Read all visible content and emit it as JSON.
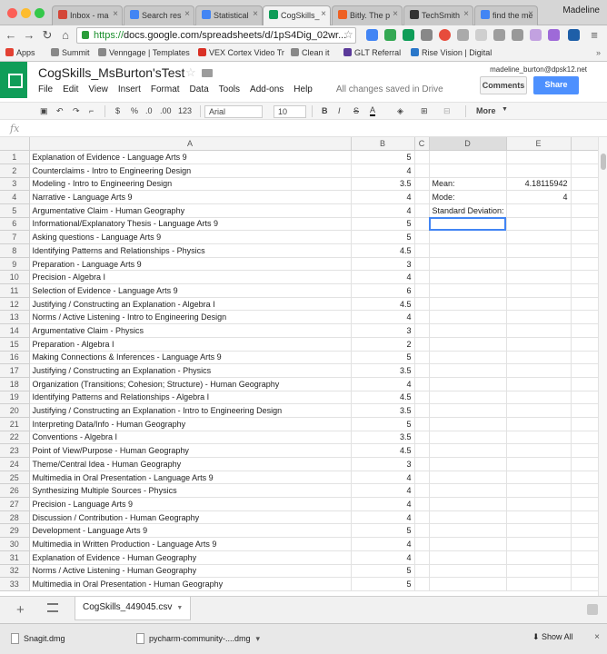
{
  "browser": {
    "tabs": [
      {
        "label": "Inbox - ma",
        "color": "#d44638"
      },
      {
        "label": "Search res",
        "color": "#4285f4"
      },
      {
        "label": "Statistical",
        "color": "#4285f4"
      },
      {
        "label": "CogSkills_",
        "color": "#0f9d58",
        "active": true
      },
      {
        "label": "Bitly. The p",
        "color": "#ee6123"
      },
      {
        "label": "TechSmith",
        "color": "#333333"
      },
      {
        "label": "find the me",
        "color": "#4285f4"
      }
    ],
    "profile": "Madeline",
    "url_scheme": "https://",
    "url_rest": "docs.google.com/spreadsheets/d/1pS4Dig_02wr..."
  },
  "bookmarks": [
    {
      "label": "Apps",
      "color": "#e34133"
    },
    {
      "label": "Summit",
      "color": "#888888"
    },
    {
      "label": "Venngage | Templates",
      "color": "#888888"
    },
    {
      "label": "VEX Cortex Video Tr",
      "color": "#d93025"
    },
    {
      "label": "Clean it",
      "color": "#888888"
    },
    {
      "label": "GLT Referral",
      "color": "#5b3a9a"
    },
    {
      "label": "Rise Vision | Digital",
      "color": "#2a77c9"
    }
  ],
  "docs": {
    "title": "CogSkills_MsBurton'sTest",
    "menu": [
      "File",
      "Edit",
      "View",
      "Insert",
      "Format",
      "Data",
      "Tools",
      "Add-ons",
      "Help"
    ],
    "saved_status": "All changes saved in Drive",
    "user_email": "madeline_burton@dpsk12.net",
    "comments_label": "Comments",
    "share_label": "Share"
  },
  "toolbar": {
    "currency": "$",
    "percent": "%",
    "decrease_decimal": ".0",
    "increase_decimal": ".00",
    "number_format": "123",
    "font": "Arial",
    "font_size": "10",
    "bold": "B",
    "italic": "I",
    "strike": "S",
    "text_color": "A",
    "more": "More"
  },
  "formula_bar": {
    "fx": "fx"
  },
  "grid": {
    "columns": [
      "A",
      "B",
      "C",
      "D",
      "E"
    ],
    "rows": [
      {
        "a": "Explanation of Evidence - Language Arts 9",
        "b": "5",
        "d": "",
        "e": ""
      },
      {
        "a": "Counterclaims - Intro to Engineering Design",
        "b": "4",
        "d": "",
        "e": ""
      },
      {
        "a": "Modeling - Intro to Engineering Design",
        "b": "3.5",
        "d": "Mean:",
        "e": "4.18115942"
      },
      {
        "a": "Narrative - Language Arts 9",
        "b": "4",
        "d": "Mode:",
        "e": "4"
      },
      {
        "a": "Argumentative Claim - Human Geography",
        "b": "4",
        "d": "Standard Deviation:",
        "e": ""
      },
      {
        "a": "Informational/Explanatory Thesis - Language Arts 9",
        "b": "5",
        "d": "",
        "e": ""
      },
      {
        "a": "Asking questions - Language Arts 9",
        "b": "5",
        "d": "",
        "e": ""
      },
      {
        "a": "Identifying Patterns and Relationships - Physics",
        "b": "4.5",
        "d": "",
        "e": ""
      },
      {
        "a": "Preparation - Language Arts 9",
        "b": "3",
        "d": "",
        "e": ""
      },
      {
        "a": "Precision - Algebra I",
        "b": "4",
        "d": "",
        "e": ""
      },
      {
        "a": "Selection of Evidence - Language Arts 9",
        "b": "6",
        "d": "",
        "e": ""
      },
      {
        "a": "Justifying / Constructing an Explanation - Algebra I",
        "b": "4.5",
        "d": "",
        "e": ""
      },
      {
        "a": "Norms / Active Listening - Intro to Engineering Design",
        "b": "4",
        "d": "",
        "e": ""
      },
      {
        "a": "Argumentative Claim - Physics",
        "b": "3",
        "d": "",
        "e": ""
      },
      {
        "a": "Preparation - Algebra I",
        "b": "2",
        "d": "",
        "e": ""
      },
      {
        "a": "Making Connections & Inferences - Language Arts 9",
        "b": "5",
        "d": "",
        "e": ""
      },
      {
        "a": "Justifying / Constructing an Explanation - Physics",
        "b": "3.5",
        "d": "",
        "e": ""
      },
      {
        "a": "Organization (Transitions; Cohesion; Structure) - Human Geography",
        "b": "4",
        "d": "",
        "e": ""
      },
      {
        "a": "Identifying Patterns and Relationships - Algebra I",
        "b": "4.5",
        "d": "",
        "e": ""
      },
      {
        "a": "Justifying / Constructing an Explanation - Intro to Engineering Design",
        "b": "3.5",
        "d": "",
        "e": ""
      },
      {
        "a": "Interpreting Data/Info - Human Geography",
        "b": "5",
        "d": "",
        "e": ""
      },
      {
        "a": "Conventions - Algebra I",
        "b": "3.5",
        "d": "",
        "e": ""
      },
      {
        "a": "Point of View/Purpose - Human Geography",
        "b": "4.5",
        "d": "",
        "e": ""
      },
      {
        "a": "Theme/Central Idea - Human Geography",
        "b": "3",
        "d": "",
        "e": ""
      },
      {
        "a": "Multimedia in Oral Presentation - Language Arts 9",
        "b": "4",
        "d": "",
        "e": ""
      },
      {
        "a": "Synthesizing Multiple Sources - Physics",
        "b": "4",
        "d": "",
        "e": ""
      },
      {
        "a": "Precision - Language Arts 9",
        "b": "4",
        "d": "",
        "e": ""
      },
      {
        "a": "Discussion / Contribution - Human Geography",
        "b": "4",
        "d": "",
        "e": ""
      },
      {
        "a": "Development - Language Arts 9",
        "b": "5",
        "d": "",
        "e": ""
      },
      {
        "a": "Multimedia in Written Production - Language Arts 9",
        "b": "4",
        "d": "",
        "e": ""
      },
      {
        "a": "Explanation of Evidence - Human Geography",
        "b": "4",
        "d": "",
        "e": ""
      },
      {
        "a": "Norms / Active Listening - Human Geography",
        "b": "5",
        "d": "",
        "e": ""
      },
      {
        "a": "Multimedia in Oral Presentation - Human Geography",
        "b": "5",
        "d": "",
        "e": ""
      }
    ],
    "selected_row": 6,
    "selected_col": "D"
  },
  "sheet_tabs": [
    {
      "label": "CogSkills_449045.csv"
    }
  ],
  "downloads": [
    {
      "label": "Snagit.dmg"
    },
    {
      "label": "pycharm-community-....dmg"
    }
  ],
  "download_bar": {
    "show_all": "Show All",
    "close": "×"
  }
}
